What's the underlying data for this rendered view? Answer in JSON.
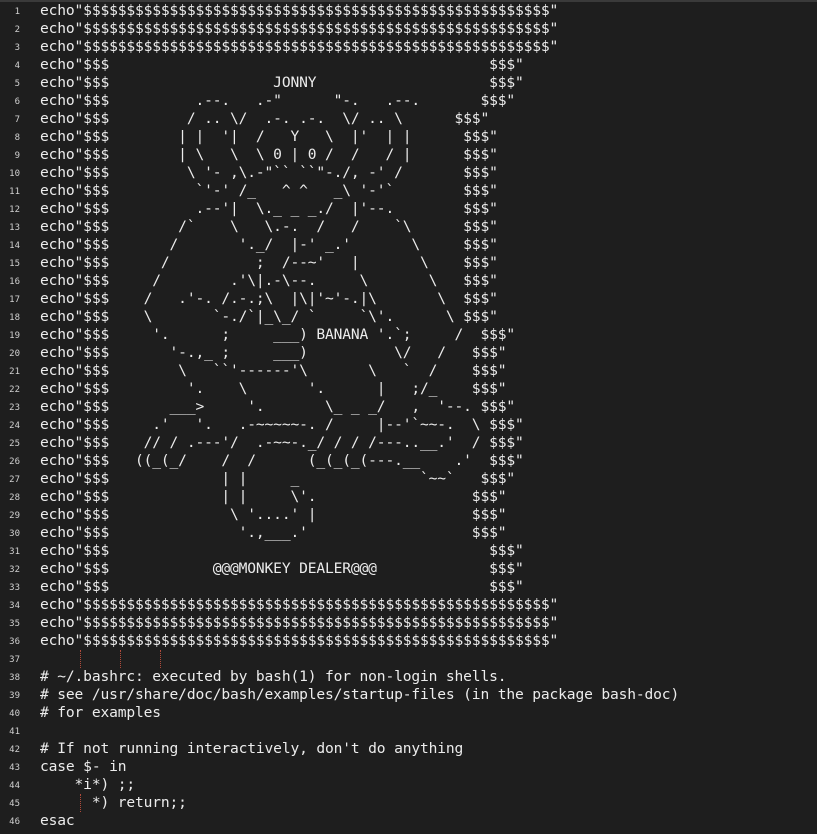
{
  "editor": {
    "lines": [
      {
        "n": "1",
        "text": "echo\"$$$$$$$$$$$$$$$$$$$$$$$$$$$$$$$$$$$$$$$$$$$$$$$$$$$$$$\""
      },
      {
        "n": "2",
        "text": "echo\"$$$$$$$$$$$$$$$$$$$$$$$$$$$$$$$$$$$$$$$$$$$$$$$$$$$$$$\""
      },
      {
        "n": "3",
        "text": "echo\"$$$$$$$$$$$$$$$$$$$$$$$$$$$$$$$$$$$$$$$$$$$$$$$$$$$$$$\""
      },
      {
        "n": "4",
        "text": "echo\"$$$                                            $$$\""
      },
      {
        "n": "5",
        "text": "echo\"$$$                   JONNY                    $$$\""
      },
      {
        "n": "6",
        "text": "echo\"$$$          .--.   .-\"      \"-.   .--.       $$$\""
      },
      {
        "n": "7",
        "text": "echo\"$$$         / .. \\/  .-. .-.  \\/ .. \\      $$$\""
      },
      {
        "n": "8",
        "text": "echo\"$$$        | |  '|  /   Y   \\  |'  | |      $$$\""
      },
      {
        "n": "9",
        "text": "echo\"$$$        | \\   \\  \\ 0 | 0 /  /   / |      $$$\""
      },
      {
        "n": "10",
        "text": "echo\"$$$         \\ '- ,\\.-\"`` ``\"-./, -' /       $$$\""
      },
      {
        "n": "11",
        "text": "echo\"$$$          `'-' /_   ^ ^   _\\ '-'`        $$$\""
      },
      {
        "n": "12",
        "text": "echo\"$$$          .--'|  \\._ _ _./  |'--.        $$$\""
      },
      {
        "n": "13",
        "text": "echo\"$$$        /`    \\   \\.-.  /   /    `\\      $$$\""
      },
      {
        "n": "14",
        "text": "echo\"$$$       /       '._/  |-' _.'       \\     $$$\""
      },
      {
        "n": "15",
        "text": "echo\"$$$      /          ;  /--~'   |       \\    $$$\""
      },
      {
        "n": "16",
        "text": "echo\"$$$     /        .'\\|.-\\--.     \\       \\   $$$\""
      },
      {
        "n": "17",
        "text": "echo\"$$$    /   .'-. /.-.;\\  |\\|'~'-.|\\       \\  $$$\""
      },
      {
        "n": "18",
        "text": "echo\"$$$    \\       `-./`|_\\_/ `     `\\'.      \\ $$$\""
      },
      {
        "n": "19",
        "text": "echo\"$$$     '.      ;     ___) BANANA '.`;     /  $$$\""
      },
      {
        "n": "20",
        "text": "echo\"$$$       '-.,_ ;     ___)          \\/   /   $$$\""
      },
      {
        "n": "21",
        "text": "echo\"$$$        \\   ``'------'\\       \\   `  /    $$$\""
      },
      {
        "n": "22",
        "text": "echo\"$$$         '.    \\       '.      |   ;/_    $$$\""
      },
      {
        "n": "23",
        "text": "echo\"$$$       ___>     '.       \\_ _ _/   ,  '--. $$$\""
      },
      {
        "n": "24",
        "text": "echo\"$$$     .'   '.   .-~~~~~-. /     |--'`~~-.  \\ $$$\""
      },
      {
        "n": "25",
        "text": "echo\"$$$    // / .---'/  .-~~-._/ / / /---..__.'  / $$$\""
      },
      {
        "n": "26",
        "text": "echo\"$$$   ((_(_/    /  /      (_(_(_(---.__    .'  $$$\""
      },
      {
        "n": "27",
        "text": "echo\"$$$             | |     _              `~~`   $$$\""
      },
      {
        "n": "28",
        "text": "echo\"$$$             | |     \\'.                  $$$\""
      },
      {
        "n": "29",
        "text": "echo\"$$$              \\ '....' |                  $$$\""
      },
      {
        "n": "30",
        "text": "echo\"$$$               '.,___.'                   $$$\""
      },
      {
        "n": "31",
        "text": "echo\"$$$                                            $$$\""
      },
      {
        "n": "32",
        "text": "echo\"$$$            @@@MONKEY DEALER@@@             $$$\""
      },
      {
        "n": "33",
        "text": "echo\"$$$                                            $$$\""
      },
      {
        "n": "34",
        "text": "echo\"$$$$$$$$$$$$$$$$$$$$$$$$$$$$$$$$$$$$$$$$$$$$$$$$$$$$$$\""
      },
      {
        "n": "35",
        "text": "echo\"$$$$$$$$$$$$$$$$$$$$$$$$$$$$$$$$$$$$$$$$$$$$$$$$$$$$$$\""
      },
      {
        "n": "36",
        "text": "echo\"$$$$$$$$$$$$$$$$$$$$$$$$$$$$$$$$$$$$$$$$$$$$$$$$$$$$$$\""
      },
      {
        "n": "37",
        "text": ""
      },
      {
        "n": "38",
        "text": "# ~/.bashrc: executed by bash(1) for non-login shells."
      },
      {
        "n": "39",
        "text": "# see /usr/share/doc/bash/examples/startup-files (in the package bash-doc)"
      },
      {
        "n": "40",
        "text": "# for examples"
      },
      {
        "n": "41",
        "text": ""
      },
      {
        "n": "42",
        "text": "# If not running interactively, don't do anything"
      },
      {
        "n": "43",
        "text": "case $- in"
      },
      {
        "n": "44",
        "text": "    *i*) ;;"
      },
      {
        "n": "45",
        "text": "      *) return;;"
      },
      {
        "n": "46",
        "text": "esac"
      }
    ]
  }
}
